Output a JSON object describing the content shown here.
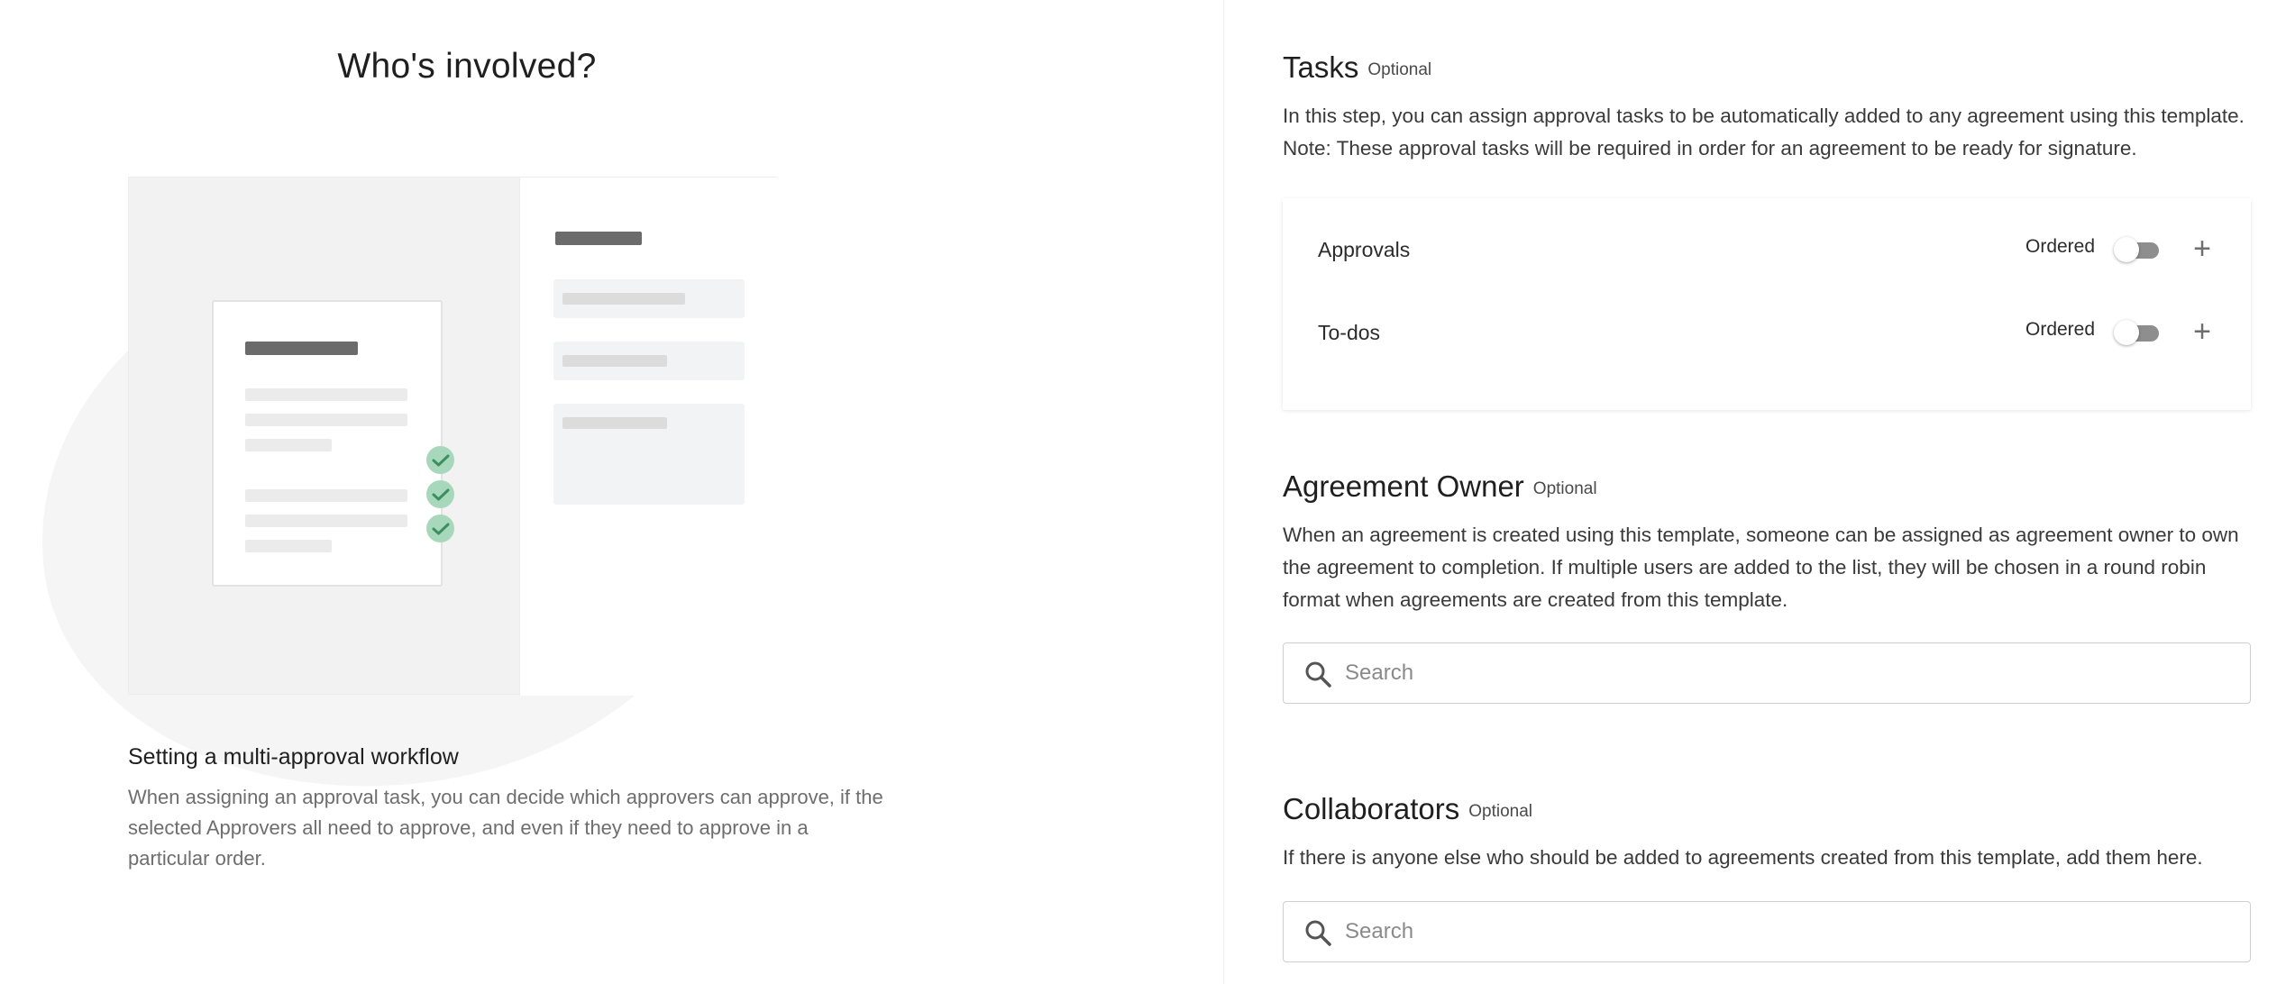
{
  "left": {
    "title": "Who's involved?",
    "subtitle": "Setting a multi-approval workflow",
    "description": "When assigning an approval task, you can decide which approvers can approve, if the selected Approvers all need to approve, and even if they need to approve in a particular order."
  },
  "tasks": {
    "title": "Tasks",
    "optional": "Optional",
    "description": "In this step, you can assign approval tasks to be automatically added to any agreement using this template. Note: These approval tasks will be required in order for an agreement to be ready for signature.",
    "rows": [
      {
        "label": "Approvals",
        "ordered_label": "Ordered",
        "ordered": false,
        "add_icon": "plus-icon"
      },
      {
        "label": "To-dos",
        "ordered_label": "Ordered",
        "ordered": false,
        "add_icon": "plus-icon"
      }
    ]
  },
  "agreement_owner": {
    "title": "Agreement Owner",
    "optional": "Optional",
    "description": "When an agreement is created using this template, someone can be assigned as agreement owner to own the agreement to completion. If multiple users are added to the list, they will be chosen in a round robin format when agreements are created from this template.",
    "search": {
      "placeholder": "Search",
      "value": "",
      "icon": "search-icon"
    }
  },
  "collaborators": {
    "title": "Collaborators",
    "optional": "Optional",
    "description": "If there is anyone else who should be added to agreements created from this template, add them here.",
    "search": {
      "placeholder": "Search",
      "value": "",
      "icon": "search-icon"
    }
  },
  "colors": {
    "check_green": "#a8d8bc",
    "check_mark": "#3d8f5f",
    "toggle_track": "#8e8e8e",
    "border": "#cfcfcf"
  }
}
